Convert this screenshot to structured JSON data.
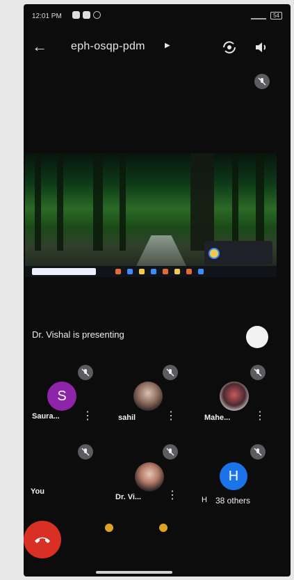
{
  "status_bar": {
    "time": "12:01 PM",
    "battery": "54"
  },
  "header": {
    "meeting_code": "eph-osqp-pdm"
  },
  "share": {
    "presenting_text": "Dr. Vishal is presenting"
  },
  "participants": [
    {
      "name": "Saura...",
      "initial": "S",
      "avatar_color": "#8e24aa"
    },
    {
      "name": "sahil"
    },
    {
      "name": "Mahe..."
    },
    {
      "name": "You"
    },
    {
      "name": "Dr. Vi..."
    },
    {
      "initial": "H",
      "avatar_color": "#1a73e8",
      "name_prefix": "H",
      "others_label": "38 others"
    }
  ],
  "colors": {
    "end_call": "#d93025",
    "background": "#0c0c0d"
  }
}
